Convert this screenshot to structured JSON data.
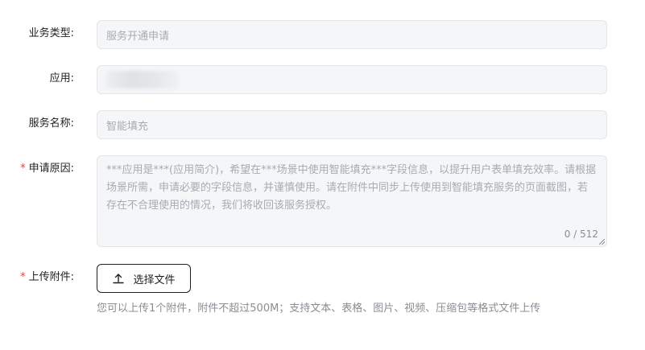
{
  "form": {
    "business_type": {
      "label": "业务类型:",
      "value": "服务开通申请"
    },
    "application": {
      "label": "应用:"
    },
    "service_name": {
      "label": "服务名称:",
      "value": "智能填充"
    },
    "reason": {
      "required_mark": "*",
      "label": "申请原因:",
      "placeholder": "***应用是***(应用简介)，希望在***场景中使用智能填充***字段信息，以提升用户表单填充效率。请根据场景所需，申请必要的字段信息，并谨慎使用。请在附件中同步上传使用到智能填充服务的页面截图，若存在不合理使用的情况，我们将收回该服务授权。",
      "counter": "0 / 512"
    },
    "attachment": {
      "required_mark": "*",
      "label": "上传附件:",
      "button_label": "选择文件",
      "hint": "您可以上传1个附件，附件不超过500M；支持文本、表格、图片、视频、压缩包等格式文件上传"
    }
  },
  "icons": {
    "upload": "upload-arrow-icon"
  }
}
